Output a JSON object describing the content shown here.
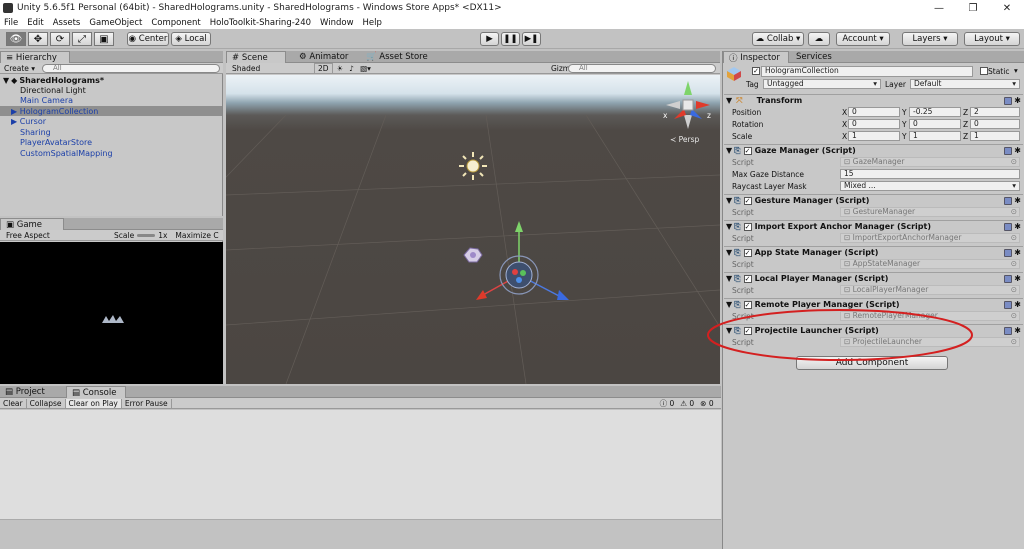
{
  "window": {
    "title": "Unity 5.6.5f1 Personal (64bit) - SharedHolograms.unity - SharedHolograms - Windows Store Apps* <DX11>"
  },
  "menu": [
    "File",
    "Edit",
    "Assets",
    "GameObject",
    "Component",
    "HoloToolkit-Sharing-240",
    "Window",
    "Help"
  ],
  "toolbar": {
    "center": "Center",
    "local": "Local",
    "collab": "Collab ▾",
    "account": "Account",
    "layers": "Layers",
    "layout": "Layout"
  },
  "hierarchy": {
    "tab": "Hierarchy",
    "create": "Create ▾",
    "search": "All",
    "scene": "SharedHolograms*",
    "items": [
      "Directional Light",
      "Main Camera",
      "HologramCollection",
      "Cursor",
      "Sharing",
      "PlayerAvatarStore",
      "CustomSpatialMapping"
    ]
  },
  "scene": {
    "tabs": [
      "Scene",
      "Animator",
      "Asset Store"
    ],
    "shaded": "Shaded",
    "mode2d": "2D",
    "gizmos": "Gizmos ▾",
    "search": "All",
    "persp": "Persp",
    "axis_x": "x",
    "axis_z": "z"
  },
  "game": {
    "tab": "Game",
    "aspect": "Free Aspect",
    "scale_label": "Scale",
    "scale_value": "1x",
    "maximize": "Maximize C"
  },
  "console": {
    "tabs": [
      "Project",
      "Console"
    ],
    "buttons": [
      "Clear",
      "Collapse",
      "Clear on Play",
      "Error Pause"
    ],
    "counts": [
      "0",
      "0",
      "0"
    ]
  },
  "inspector": {
    "tabs": [
      "Inspector",
      "Services"
    ],
    "object_name": "HologramCollection",
    "static_label": "Static",
    "tag_label": "Tag",
    "tag_value": "Untagged",
    "layer_label": "Layer",
    "layer_value": "Default",
    "transform": {
      "title": "Transform",
      "position": {
        "label": "Position",
        "x": "0",
        "y": "-0.25",
        "z": "2"
      },
      "rotation": {
        "label": "Rotation",
        "x": "0",
        "y": "0",
        "z": "0"
      },
      "scale": {
        "label": "Scale",
        "x": "1",
        "y": "1",
        "z": "1"
      }
    },
    "gaze": {
      "title": "Gaze Manager (Script)",
      "script_label": "Script",
      "script_value": "GazeManager",
      "max_label": "Max Gaze Distance",
      "max_value": "15",
      "mask_label": "Raycast Layer Mask",
      "mask_value": "Mixed ..."
    },
    "components": [
      {
        "title": "Gesture Manager (Script)",
        "script": "GestureManager"
      },
      {
        "title": "Import Export Anchor Manager (Script)",
        "script": "ImportExportAnchorManager"
      },
      {
        "title": "App State Manager (Script)",
        "script": "AppStateManager"
      },
      {
        "title": "Local Player Manager (Script)",
        "script": "LocalPlayerManager"
      },
      {
        "title": "Remote Player Manager (Script)",
        "script": "RemotePlayerManager"
      },
      {
        "title": "Projectile Launcher (Script)",
        "script": "ProjectileLauncher"
      }
    ],
    "script_label": "Script",
    "add_component": "Add Component"
  },
  "colors": {
    "highlight_ellipse": "#d42020",
    "scene_sky": "#dde8ef",
    "scene_ground": "#4d4844"
  }
}
